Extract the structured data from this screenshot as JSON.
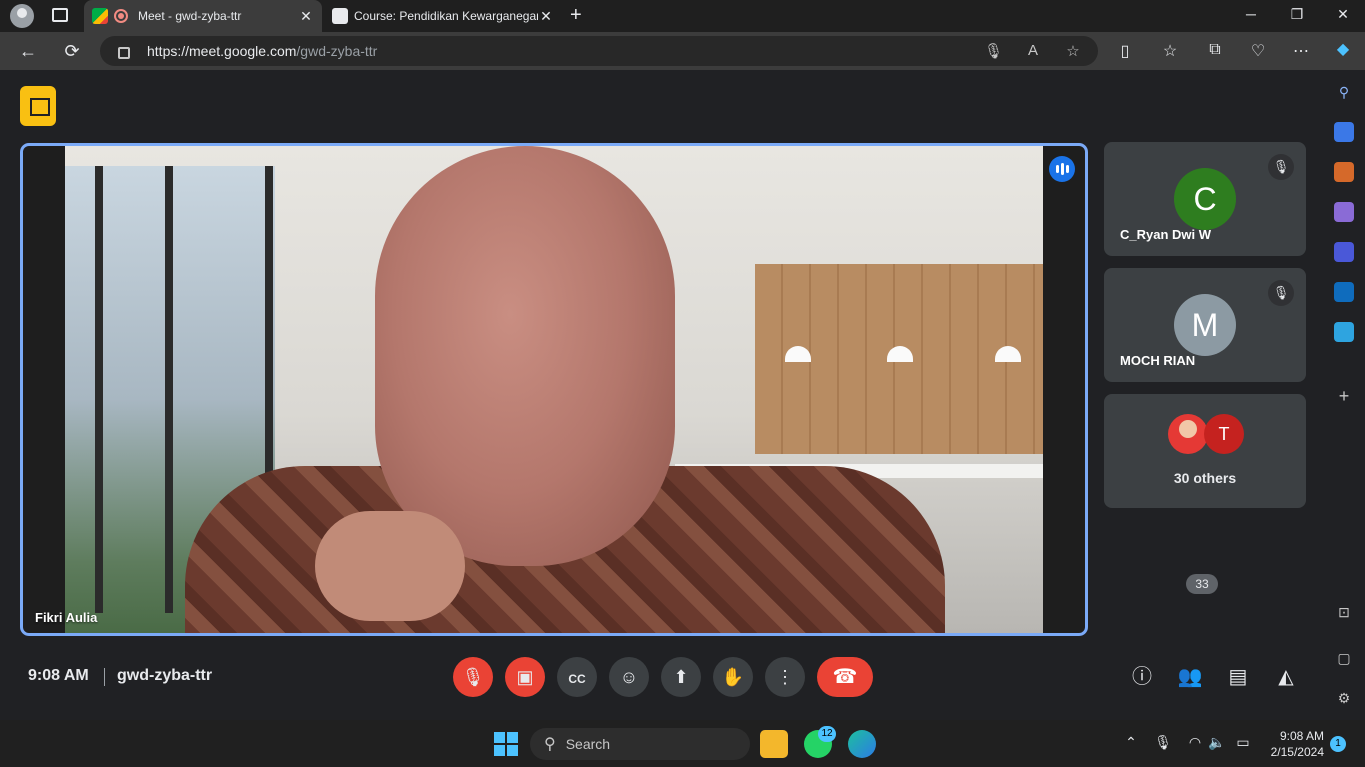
{
  "browser": {
    "tabs": [
      {
        "title": "Meet - gwd-zyba-ttr",
        "active": true
      },
      {
        "title": "Course: Pendidikan Kewarganegaraan",
        "active": false
      }
    ],
    "url_domain": "https://meet.google.com",
    "url_path": "/gwd-zyba-ttr"
  },
  "meet": {
    "main_speaker": "Fikri Aulia",
    "participants": [
      {
        "name": "C_Ryan Dwi W",
        "initial": "C",
        "color": "#2e7d1f",
        "muted": true
      },
      {
        "name": "MOCH RIAN",
        "initial": "M",
        "color": "#8c9aa3",
        "muted": true
      }
    ],
    "others": {
      "label": "30 others",
      "avatar_initial": "T",
      "avatar_color": "#c5221f"
    },
    "time": "9:08 AM",
    "meeting_code": "gwd-zyba-ttr",
    "people_count": "33"
  },
  "taskbar": {
    "search_placeholder": "Search",
    "whatsapp_badge": "12",
    "clock_time": "9:08 AM",
    "clock_date": "2/15/2024",
    "notification_count": "1"
  },
  "colors": {
    "accent_blue": "#1a73e8",
    "danger_red": "#ea4335",
    "badge_yellow": "#f9c012"
  }
}
